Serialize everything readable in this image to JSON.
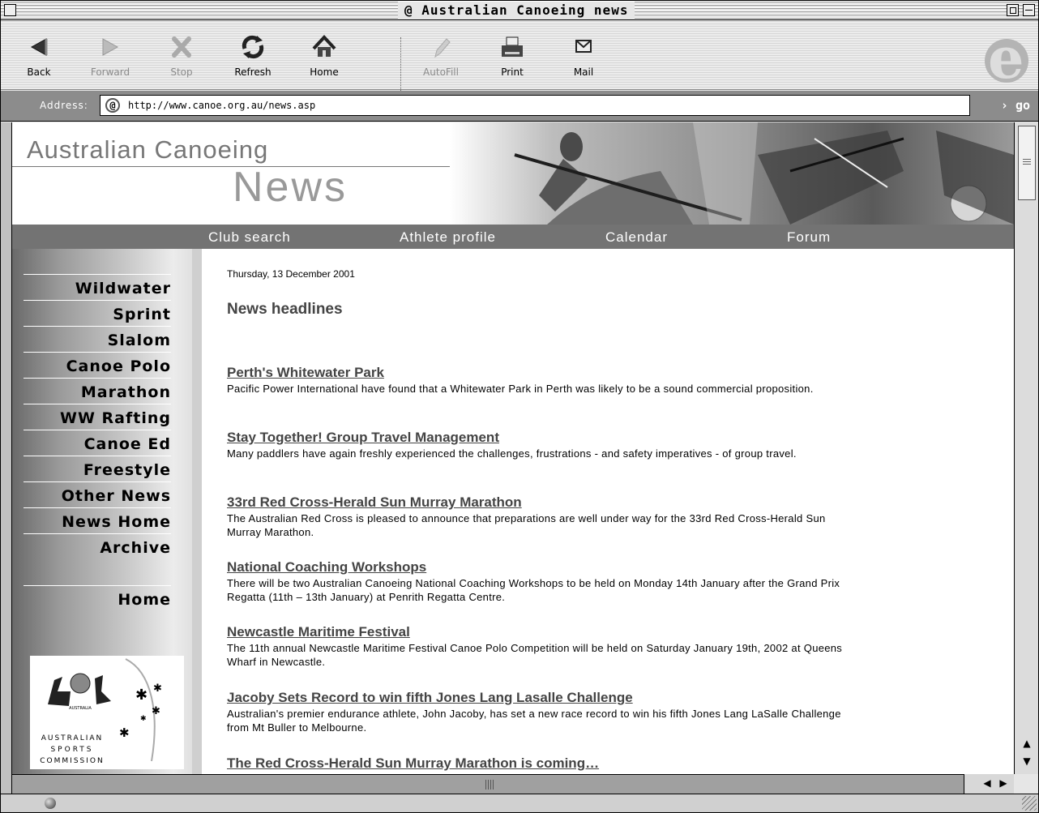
{
  "window": {
    "title": "Australian Canoeing news"
  },
  "toolbar": {
    "back": "Back",
    "forward": "Forward",
    "stop": "Stop",
    "refresh": "Refresh",
    "home": "Home",
    "autofill": "AutoFill",
    "print": "Print",
    "mail": "Mail"
  },
  "address": {
    "label": "Address:",
    "url": "http://www.canoe.org.au/news.asp",
    "go": "go"
  },
  "banner": {
    "title": "Australian Canoeing",
    "subtitle": "News"
  },
  "nav": {
    "club_search": "Club search",
    "athlete_profile": "Athlete profile",
    "calendar": "Calendar",
    "forum": "Forum"
  },
  "sidebar": {
    "items": [
      {
        "label": "Wildwater"
      },
      {
        "label": "Sprint"
      },
      {
        "label": "Slalom"
      },
      {
        "label": "Canoe Polo"
      },
      {
        "label": "Marathon"
      },
      {
        "label": "WW Rafting"
      },
      {
        "label": "Canoe Ed"
      },
      {
        "label": "Freestyle"
      },
      {
        "label": "Other News"
      },
      {
        "label": "News Home"
      },
      {
        "label": "Archive"
      },
      {
        "label": "Home"
      }
    ],
    "logo_line1": "AUSTRALIAN",
    "logo_line2": "SPORTS",
    "logo_line3": "COMMISSION",
    "logo_crest": "AUSTRALIA"
  },
  "main": {
    "date": "Thursday, 13 December 2001",
    "headline": "News headlines",
    "stories": [
      {
        "title": "Perth's Whitewater Park",
        "summary": "Pacific Power International have found that a Whitewater Park in Perth was likely to be a sound commercial proposition."
      },
      {
        "title": "Stay Together! Group Travel Management",
        "summary": "Many paddlers have again freshly experienced the challenges, frustrations - and safety imperatives - of group travel."
      },
      {
        "title": "33rd Red Cross-Herald Sun Murray Marathon",
        "summary": "The Australian Red Cross is pleased to announce that preparations are well under way for the 33rd Red Cross-Herald Sun Murray Marathon."
      },
      {
        "title": "National Coaching Workshops",
        "summary": "There will be two Australian Canoeing National Coaching Workshops to be held on Monday 14th January after the Grand Prix Regatta (11th – 13th January) at Penrith Regatta Centre."
      },
      {
        "title": "Newcastle Maritime Festival",
        "summary": "The 11th annual Newcastle Maritime Festival Canoe Polo Competition will be held on Saturday January 19th, 2002 at Queens Wharf in Newcastle."
      },
      {
        "title": "Jacoby Sets Record to win fifth Jones Lang Lasalle Challenge",
        "summary": "Australian's premier endurance athlete, John Jacoby, has set a new race record to win his fifth Jones Lang LaSalle Challenge from Mt Buller to Melbourne."
      },
      {
        "title": "The Red Cross-Herald Sun Murray Marathon is coming…",
        "summary": ""
      }
    ]
  },
  "icons": {
    "back": "back-arrow-icon",
    "forward": "forward-arrow-icon",
    "stop": "stop-x-icon",
    "refresh": "refresh-icon",
    "home": "home-icon",
    "autofill": "autofill-pen-icon",
    "print": "printer-icon",
    "mail": "envelope-icon",
    "browser_logo": "ie-logo-icon",
    "address_at": "at-sign-icon",
    "status_globe": "globe-icon"
  }
}
